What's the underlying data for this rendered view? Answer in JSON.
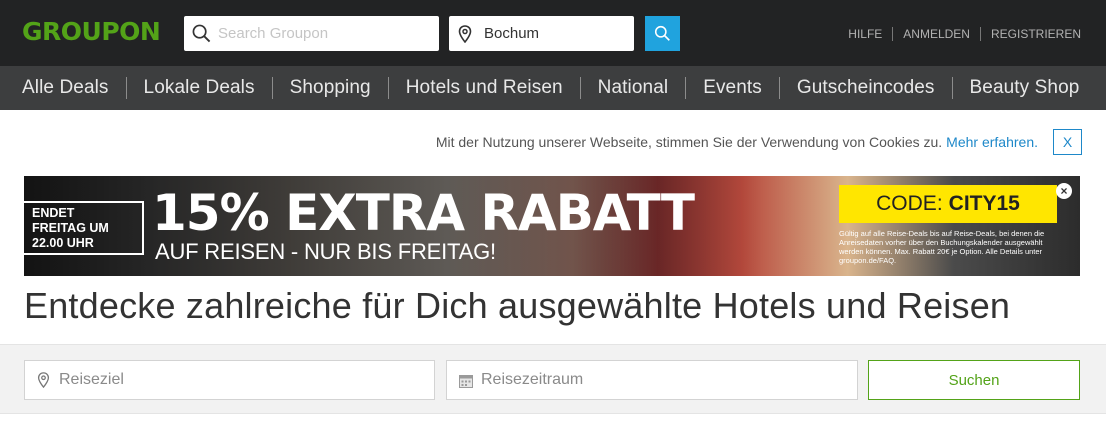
{
  "brand": {
    "logo_text": "GROUPON",
    "color": "#53a318"
  },
  "header": {
    "search": {
      "placeholder": "Search Groupon",
      "value": "",
      "icon": "search-icon"
    },
    "location": {
      "value": "Bochum",
      "icon": "map-pin-icon"
    },
    "search_button": {
      "icon": "search-icon",
      "color": "#20a3de"
    },
    "links": [
      "Hilfe",
      "Anmelden",
      "Registrieren"
    ]
  },
  "nav": {
    "items": [
      "Alle Deals",
      "Lokale Deals",
      "Shopping",
      "Hotels und Reisen",
      "National",
      "Events",
      "Gutscheincodes",
      "Beauty Shop"
    ]
  },
  "cookie_notice": {
    "text": "Mit der Nutzung unserer Webseite, stimmen Sie der Verwendung von Cookies zu.",
    "link": "Mehr erfahren.",
    "close": "X",
    "link_color": "#1e88c9"
  },
  "banner": {
    "ended": [
      "ENDET",
      "FREITAG UM",
      "22.00 UHR"
    ],
    "headline": "15% EXTRA RABATT",
    "sub": "AUF REISEN - NUR BIS FREITAG!",
    "code_label": "CODE:",
    "code_value": "CITY15",
    "fine_print": "Gültig auf alle Reise-Deals bis auf Reise-Deals, bei denen die Anreisedaten vorher über den Buchungskalender ausgewählt werden können. Max. Rabatt 20€ je Option. Alle Details unter groupon.de/FAQ.",
    "close": "×",
    "accent": "#ffe600"
  },
  "page_title": "Entdecke zahlreiche für Dich ausgewählte Hotels und Reisen",
  "travel_search": {
    "destination": {
      "placeholder": "Reiseziel",
      "icon": "map-pin-icon"
    },
    "period": {
      "placeholder": "Reisezeitraum",
      "icon": "calendar-icon"
    },
    "button": "Suchen"
  }
}
